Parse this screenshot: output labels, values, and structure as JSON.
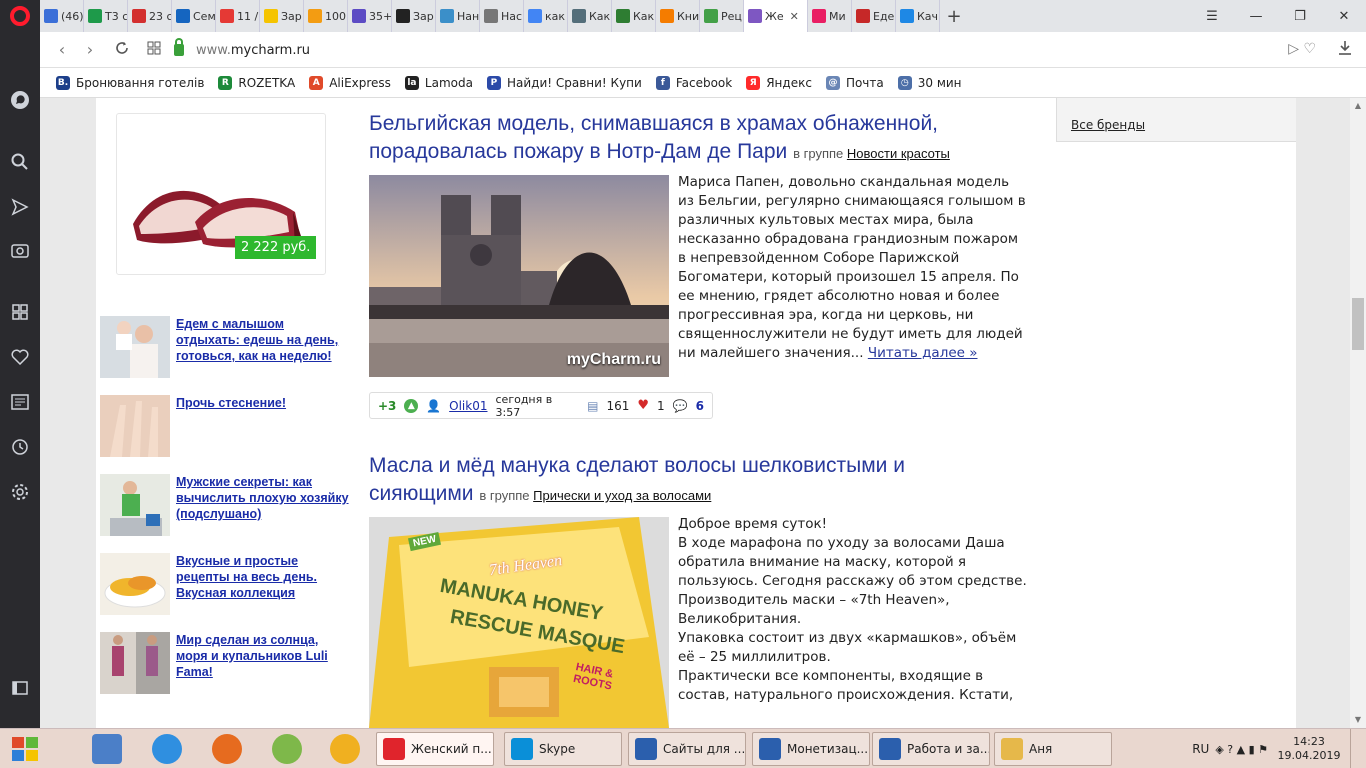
{
  "browser": {
    "tabs": [
      {
        "label": "(46)",
        "color": "#3b6fd8"
      },
      {
        "label": "Т3 с",
        "color": "#1e9a4a"
      },
      {
        "label": "23 с",
        "color": "#d32f2f"
      },
      {
        "label": "Сем",
        "color": "#1565c0"
      },
      {
        "label": "11 /",
        "color": "#e53935"
      },
      {
        "label": "Зар",
        "color": "#f5c400"
      },
      {
        "label": "100",
        "color": "#f39c12"
      },
      {
        "label": "35+",
        "color": "#5c4bc4"
      },
      {
        "label": "Зар",
        "color": "#222222"
      },
      {
        "label": "Нан",
        "color": "#3b8fc9"
      },
      {
        "label": "Нас",
        "color": "#777777"
      },
      {
        "label": "как",
        "color": "#4285f4"
      },
      {
        "label": "Как",
        "color": "#546e7a"
      },
      {
        "label": "Как",
        "color": "#2e7d32"
      },
      {
        "label": "Кни",
        "color": "#f57c00"
      },
      {
        "label": "Рец",
        "color": "#43a047"
      },
      {
        "label": "Же",
        "color": "#7e57c2",
        "active": true
      },
      {
        "label": "Ми",
        "color": "#e91e63"
      },
      {
        "label": "Еде",
        "color": "#c62828"
      },
      {
        "label": "Кач",
        "color": "#1e88e5"
      }
    ],
    "new_tab": "+",
    "url_prefix": "www.",
    "url_host": "mycharm.ru"
  },
  "bookmarks": [
    {
      "label": "Бронювання готелів",
      "icon": "B.",
      "color": "#1d3f8a"
    },
    {
      "label": "ROZETKA",
      "icon": "R",
      "color": "#1d8a3a"
    },
    {
      "label": "AliExpress",
      "icon": "A",
      "color": "#e04a2a"
    },
    {
      "label": "Lamoda",
      "icon": "la",
      "color": "#222222"
    },
    {
      "label": "Найди! Сравни! Купи",
      "icon": "P",
      "color": "#2c4aa8"
    },
    {
      "label": "Facebook",
      "icon": "f",
      "color": "#3b5998"
    },
    {
      "label": "Яндекс",
      "icon": "Я",
      "color": "#ff2a2a"
    },
    {
      "label": "Почта",
      "icon": "@",
      "color": "#6a86b5"
    },
    {
      "label": "30 мин",
      "icon": "◷",
      "color": "#4d6fa8"
    }
  ],
  "page": {
    "product_price": "2 222 руб.",
    "promos": [
      {
        "text": "Едем с малышом отдыхать: едешь на день, готовься, как на неделю!"
      },
      {
        "text": "Прочь стеснение!"
      },
      {
        "text": "Мужские секреты: как вычислить плохую хозяйку (подслушано)"
      },
      {
        "text": "Вкусные и простые рецепты на весь день. Вкусная коллекция"
      },
      {
        "text": "Мир сделан из солнца, моря и купальников Luli Fama!"
      }
    ],
    "right_link": "Все бренды",
    "articles": [
      {
        "title": "Бельгийская модель, снимавшаяся в храмах обнаженной, порадовалась пожару в Нотр-Дам де Пари",
        "group_prefix": "в группе",
        "group": "Новости красоты",
        "watermark": "myCharm.ru",
        "text": "Мариса Папен, довольно скандальная модель из Бельгии, регулярно снимающаяся голышом в различных культовых местах мира, была несказанно обрадована грандиозным пожаром в непревзойденном Соборе Парижской Богоматери, который произошел 15 апреля. По ее мнению, грядет абсолютно новая и более прогрессивная эра, когда ни церковь, ни священнослужители не будут иметь для людей ни малейшего значения...",
        "more": "Читать далее »",
        "meta": {
          "score": "+3",
          "author": "Olik01",
          "time": "сегодня в 3:57",
          "views": "161",
          "likes": "1",
          "comments": "6"
        }
      },
      {
        "title": "Масла и мёд манука сделают волосы шелковистыми и сияющими",
        "group_prefix": "в группе",
        "group": "Прически и уход за волосами",
        "image_text_1": "7th Heaven",
        "image_text_2": "MANUKA HONEY",
        "image_text_3": "RESCUE MASQUE",
        "image_text_4": "HAIR & ROOTS",
        "image_text_5": "NEW",
        "lines": [
          "Доброе время суток!",
          "В ходе марафона по уходу за волосами Даша обратила внимание на маску, которой я пользуюсь. Сегодня расскажу об этом средстве.",
          "Производитель маски – «7th Heaven», Великобритания.",
          "Упаковка состоит из двух «кармашков», объём её – 25 миллилитров.",
          "Практически все компоненты, входящие в состав, натурального происхождения. Кстати,"
        ]
      }
    ]
  },
  "taskbar": {
    "buttons": [
      {
        "label": "Женский п...",
        "color": "#e0242c",
        "active": true
      },
      {
        "label": "Skype",
        "color": "#0a8fd8"
      },
      {
        "label": "Сайты для ...",
        "color": "#2b5fad"
      },
      {
        "label": "Монетизац...",
        "color": "#2b5fad"
      },
      {
        "label": "Работа и за...",
        "color": "#2b5fad"
      },
      {
        "label": "Аня",
        "color": "#e6b84a"
      }
    ],
    "lang": "RU",
    "time": "14:23",
    "date": "19.04.2019"
  }
}
